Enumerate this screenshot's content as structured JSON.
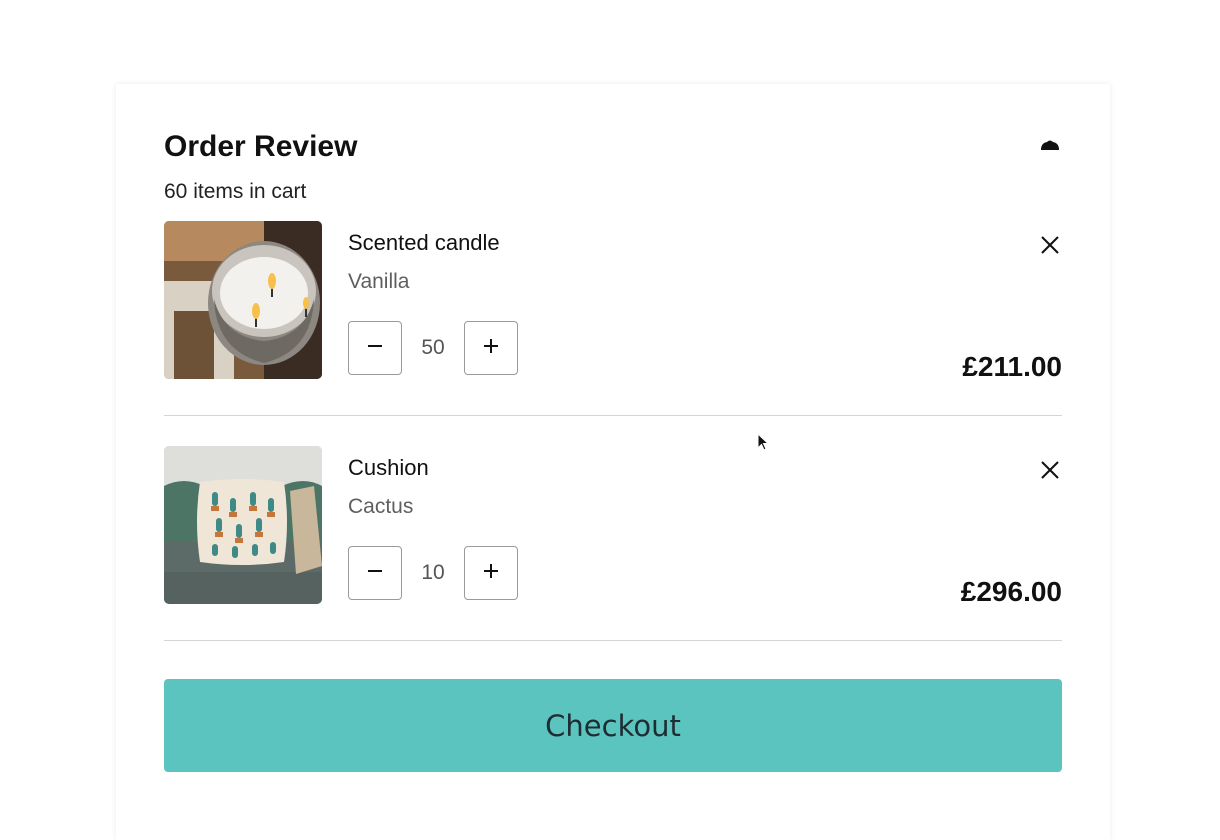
{
  "header": {
    "title": "Order Review",
    "item_count": "60 items in cart",
    "collapse_icon": "chevron-up-icon"
  },
  "items": [
    {
      "name": "Scented candle",
      "variant": "Vanilla",
      "quantity": "50",
      "price": "£211.00",
      "image": "candle-photo"
    },
    {
      "name": "Cushion",
      "variant": "Cactus",
      "quantity": "10",
      "price": "£296.00",
      "image": "cushion-photo"
    }
  ],
  "checkout": {
    "label": "Checkout"
  },
  "colors": {
    "accent": "#5bc4bf",
    "divider": "#d5d5d5",
    "muted_text": "#5f5f5f"
  },
  "icons": {
    "decrease": "minus-icon",
    "increase": "plus-icon",
    "remove": "close-icon"
  }
}
